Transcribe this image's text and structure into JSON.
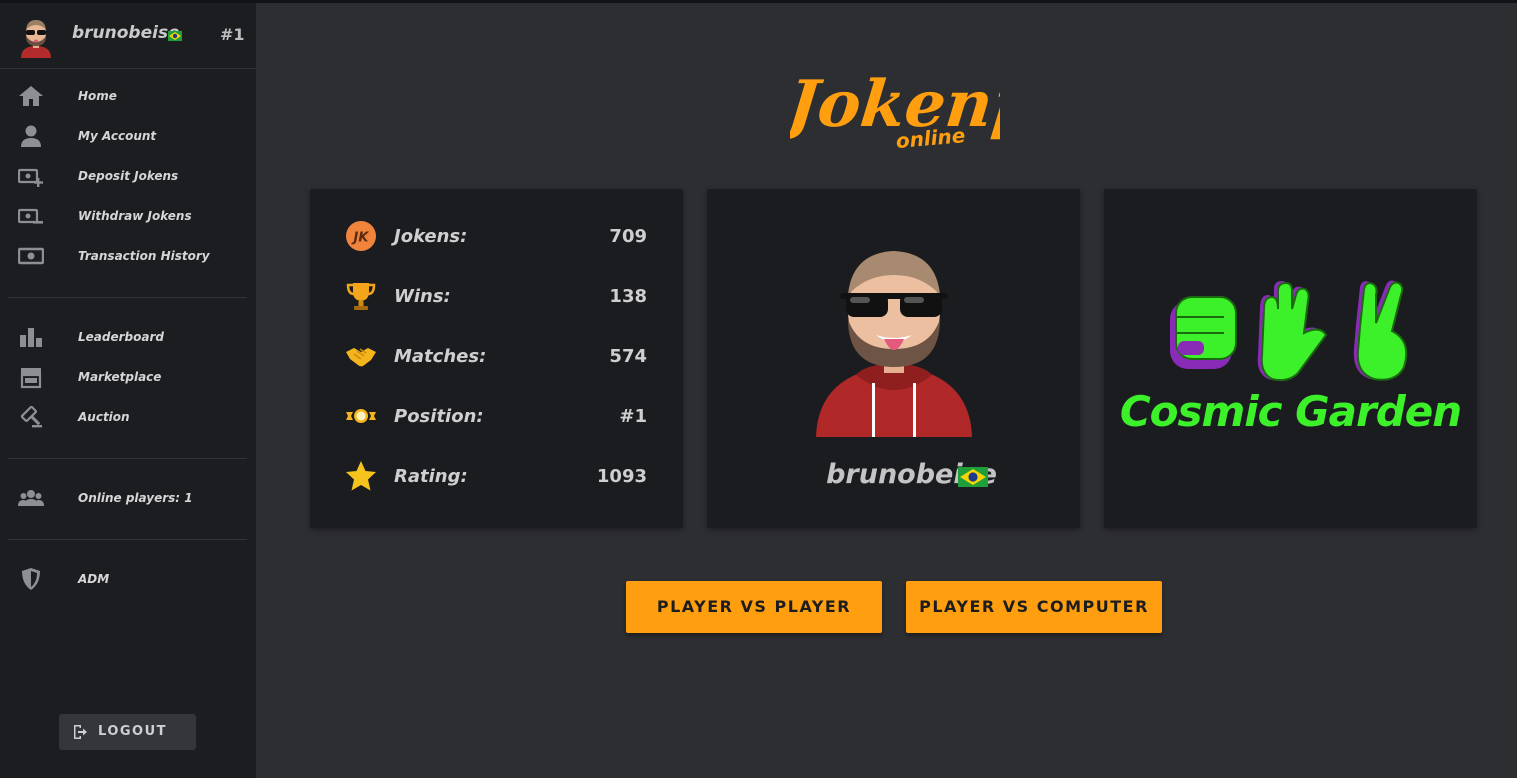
{
  "profile": {
    "username": "brunobeise",
    "rank": "#1"
  },
  "nav": {
    "group1": [
      {
        "label": "Home",
        "icon": "home-icon"
      },
      {
        "label": "My Account",
        "icon": "user-icon"
      },
      {
        "label": "Deposit Jokens",
        "icon": "deposit-icon"
      },
      {
        "label": "Withdraw Jokens",
        "icon": "withdraw-icon"
      },
      {
        "label": "Transaction History",
        "icon": "money-icon"
      }
    ],
    "group2": [
      {
        "label": "Leaderboard",
        "icon": "bar-chart-icon"
      },
      {
        "label": "Marketplace",
        "icon": "store-icon"
      },
      {
        "label": "Auction",
        "icon": "gavel-icon"
      }
    ],
    "group3": [
      {
        "label": "Online players: 1",
        "icon": "users-icon"
      }
    ],
    "group4": [
      {
        "label": "ADM",
        "icon": "shield-icon"
      }
    ],
    "logout_label": "LOGOUT"
  },
  "logo": {
    "title": "Jokenpo",
    "subtitle": "online"
  },
  "stats": [
    {
      "label": "Jokens:",
      "value": "709",
      "icon": "joken-coin-icon"
    },
    {
      "label": "Wins:",
      "value": "138",
      "icon": "trophy-icon"
    },
    {
      "label": "Matches:",
      "value": "574",
      "icon": "handshake-icon"
    },
    {
      "label": "Position:",
      "value": "#1",
      "icon": "medal-icon"
    },
    {
      "label": "Rating:",
      "value": "1093",
      "icon": "star-icon"
    }
  ],
  "player_card": {
    "name": "brunobeise"
  },
  "brand_card": {
    "name": "Cosmic Garden"
  },
  "actions": {
    "pvp_label": "PLAYER VS PLAYER",
    "pvc_label": "PLAYER VS COMPUTER"
  },
  "colors": {
    "accent": "#ff9f0f",
    "sidebar": "#1c1d21",
    "card": "#1b1c20",
    "background": "#2d2e32",
    "brand_green": "#3cf02a",
    "brand_purple": "#8a2bb8"
  }
}
